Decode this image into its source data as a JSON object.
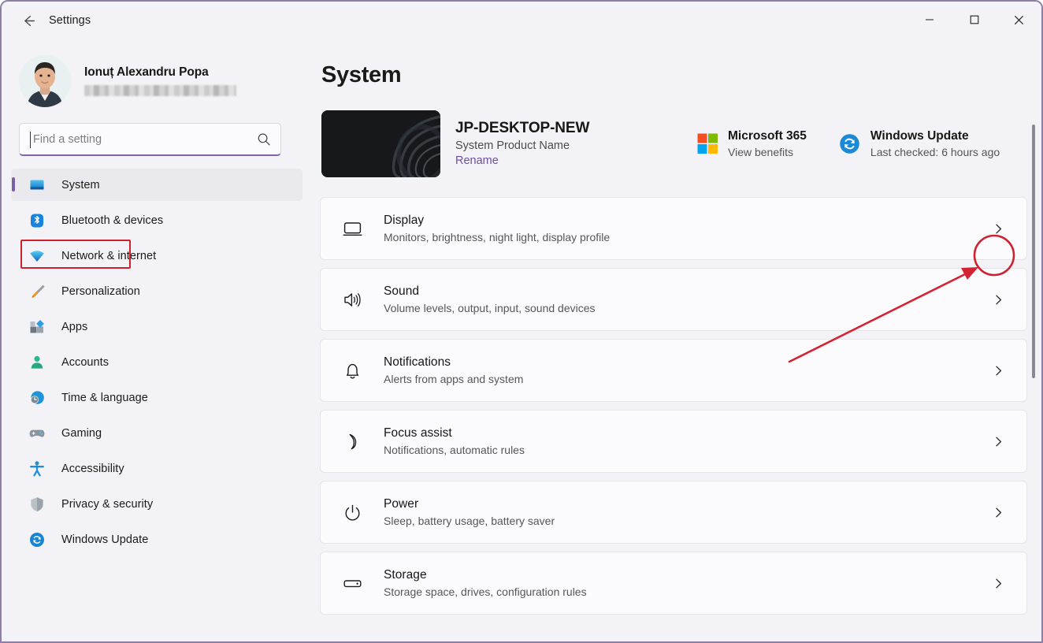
{
  "window": {
    "title": "Settings",
    "back_icon": "back-arrow-icon",
    "minimize_label": "—",
    "maximize_label": "□",
    "close_label": "✕"
  },
  "account": {
    "name": "Ionuț Alexandru Popa",
    "email_redacted": "",
    "avatar_alt": "user-avatar"
  },
  "search": {
    "placeholder": "Find a setting",
    "value": "",
    "icon": "search-icon"
  },
  "sidebar": {
    "items": [
      {
        "label": "System",
        "icon": "monitor-icon",
        "selected": true
      },
      {
        "label": "Bluetooth & devices",
        "icon": "bluetooth-icon",
        "selected": false
      },
      {
        "label": "Network & internet",
        "icon": "wifi-icon",
        "selected": false
      },
      {
        "label": "Personalization",
        "icon": "paintbrush-icon",
        "selected": false
      },
      {
        "label": "Apps",
        "icon": "apps-icon",
        "selected": false
      },
      {
        "label": "Accounts",
        "icon": "person-icon",
        "selected": false
      },
      {
        "label": "Time & language",
        "icon": "clock-globe-icon",
        "selected": false
      },
      {
        "label": "Gaming",
        "icon": "gamepad-icon",
        "selected": false
      },
      {
        "label": "Accessibility",
        "icon": "accessibility-icon",
        "selected": false
      },
      {
        "label": "Privacy & security",
        "icon": "shield-icon",
        "selected": false
      },
      {
        "label": "Windows Update",
        "icon": "refresh-icon",
        "selected": false
      }
    ]
  },
  "main": {
    "page_title": "System",
    "device": {
      "name": "JP-DESKTOP-NEW",
      "product": "System Product Name",
      "rename_label": "Rename",
      "thumbnail": "desktop-wallpaper-thumbnail"
    },
    "quick_links": [
      {
        "title": "Microsoft 365",
        "sub": "View benefits",
        "icon": "microsoft-logo-icon"
      },
      {
        "title": "Windows Update",
        "sub": "Last checked: 6 hours ago",
        "icon": "windows-update-refresh-icon"
      }
    ],
    "cards": [
      {
        "title": "Display",
        "sub": "Monitors, brightness, night light, display profile",
        "icon": "monitor-icon",
        "highlighted": true
      },
      {
        "title": "Sound",
        "sub": "Volume levels, output, input, sound devices",
        "icon": "speaker-icon",
        "highlighted": false
      },
      {
        "title": "Notifications",
        "sub": "Alerts from apps and system",
        "icon": "bell-icon",
        "highlighted": false
      },
      {
        "title": "Focus assist",
        "sub": "Notifications, automatic rules",
        "icon": "moon-icon",
        "highlighted": false
      },
      {
        "title": "Power",
        "sub": "Sleep, battery usage, battery saver",
        "icon": "power-icon",
        "highlighted": false
      },
      {
        "title": "Storage",
        "sub": "Storage space, drives, configuration rules",
        "icon": "harddrive-icon",
        "highlighted": false
      }
    ]
  },
  "annotations": {
    "highlight_color": "#cf2030",
    "arrow_color": "#d42232",
    "sidebar_box_target": "System",
    "circle_target": "display-card-chevron"
  },
  "colors": {
    "accent": "#7a5ea8",
    "window_border": "#8f7fa8",
    "page_background": "#f3f3f7",
    "card_background": "#fbfbfd",
    "link": "#6b4fa0"
  }
}
